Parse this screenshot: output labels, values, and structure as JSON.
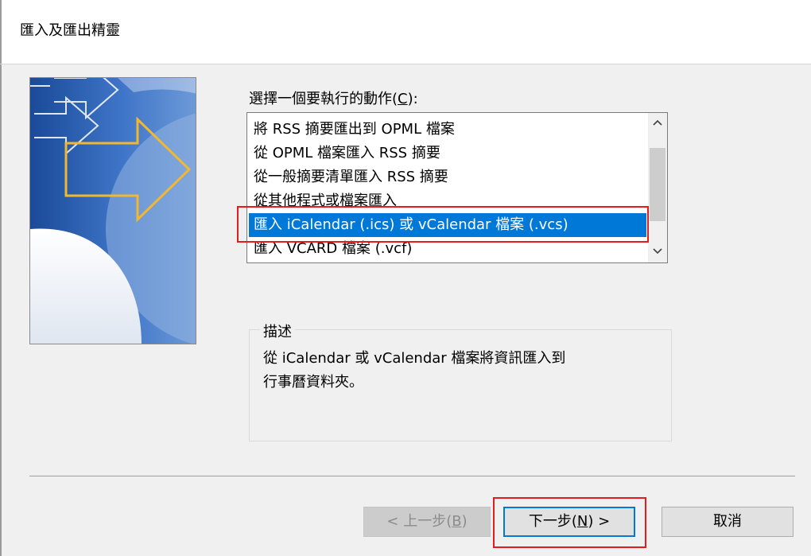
{
  "window": {
    "title": "匯入及匯出精靈"
  },
  "action_list": {
    "label": "選擇一個要執行的動作(",
    "label_key": "C",
    "label_end": "):",
    "items": [
      "將 RSS 摘要匯出到 OPML 檔案",
      "從 OPML 檔案匯入 RSS 摘要",
      "從一般摘要清單匯入 RSS 摘要",
      "從其他程式或檔案匯入",
      "匯入 iCalendar (.ics) 或 vCalendar 檔案 (.vcs)",
      "匯入 VCARD 檔案 (.vcf)"
    ],
    "selected": "匯入 iCalendar (.ics) 或 vCalendar 檔案 (.vcs)"
  },
  "description": {
    "legend": "描述",
    "line1": "從 iCalendar 或 vCalendar 檔案將資訊匯入到",
    "line2": "行事曆資料夾。"
  },
  "buttons": {
    "back": "< 上一步(",
    "back_key": "B",
    "back_end": ")",
    "next": "下一步(",
    "next_key": "N",
    "next_end": ") >",
    "cancel": "取消"
  },
  "colors": {
    "selection": "#0078d7",
    "annotation": "#e41c1c",
    "banner_blue": "#1c4d9c",
    "arrow_yellow": "#f2b731"
  },
  "icons": {
    "scroll_up": "scroll-up-arrow-icon",
    "scroll_down": "scroll-down-arrow-icon",
    "banner": "wizard-arrow-banner-icon"
  }
}
